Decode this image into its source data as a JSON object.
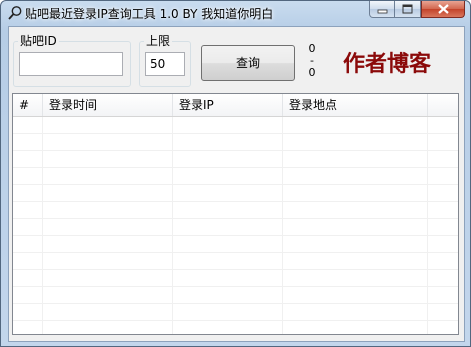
{
  "window": {
    "title": "贴吧最近登录IP查询工具 1.0 BY 我知道你明白",
    "icon": "magnifier-icon"
  },
  "form": {
    "tieba_id_label": "贴吧ID",
    "tieba_id_value": "",
    "limit_label": "上限",
    "limit_value": "50",
    "query_button_label": "查询",
    "counter_top": "0",
    "counter_mid": "-",
    "counter_bottom": "0",
    "author_link": "作者博客",
    "author_link_color": "#8b0a0a"
  },
  "table": {
    "columns": [
      "#",
      "登录时间",
      "登录IP",
      "登录地点"
    ],
    "rows": []
  },
  "caption_buttons": {
    "minimize": "minimize-icon",
    "maximize": "maximize-icon",
    "close": "close-icon"
  }
}
